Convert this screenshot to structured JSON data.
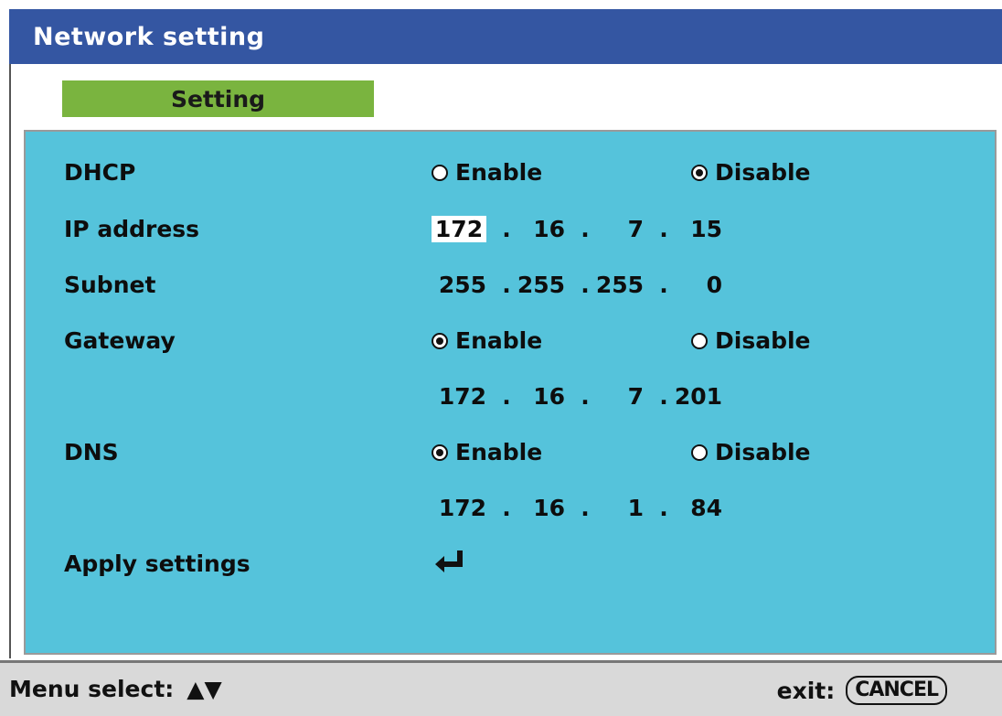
{
  "window": {
    "title": "Network setting"
  },
  "tab": {
    "label": "Setting"
  },
  "rows": {
    "dhcp": {
      "label": "DHCP",
      "options": [
        "Enable",
        "Disable"
      ],
      "selected": "Disable"
    },
    "ip_address": {
      "label": "IP address",
      "octets": [
        "172",
        "16",
        "7",
        "15"
      ],
      "dot": "."
    },
    "subnet": {
      "label": "Subnet",
      "octets": [
        "255",
        "255",
        "255",
        "0"
      ],
      "dot": "."
    },
    "gateway": {
      "label": "Gateway",
      "options": [
        "Enable",
        "Disable"
      ],
      "selected": "Enable",
      "octets": [
        "172",
        "16",
        "7",
        "201"
      ],
      "dot": "."
    },
    "dns": {
      "label": "DNS",
      "options": [
        "Enable",
        "Disable"
      ],
      "selected": "Enable",
      "octets": [
        "172",
        "16",
        "1",
        "84"
      ],
      "dot": "."
    },
    "apply": {
      "label": "Apply settings",
      "icon": "enter-icon"
    }
  },
  "status_bar": {
    "menu_select_label": "Menu select:",
    "menu_select_icon": "up-down-arrows-icon",
    "arrows_text": "▲▼",
    "exit_label": "exit:",
    "cancel_key": "CANCEL"
  },
  "colors": {
    "title_bar": "#3456a2",
    "tab": "#7ab43f",
    "panel": "#55c3db",
    "status_bar": "#d9d9d9"
  }
}
